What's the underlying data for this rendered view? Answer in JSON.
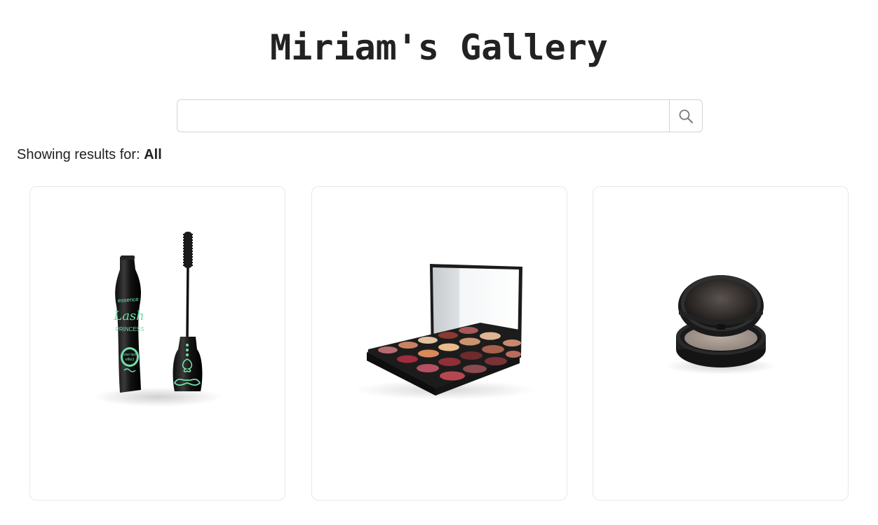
{
  "header": {
    "title": "Miriam's Gallery"
  },
  "search": {
    "value": "",
    "placeholder": "",
    "icon": "search-icon"
  },
  "results": {
    "prefix": "Showing results for: ",
    "filter": "All"
  },
  "gallery": {
    "items": [
      {
        "name": "mascara",
        "brand_text": "essence",
        "product_text": "Lash Princess"
      },
      {
        "name": "eyeshadow-palette"
      },
      {
        "name": "compact-powder"
      }
    ]
  },
  "colors": {
    "text": "#222222",
    "border": "#cfd4da",
    "card_border": "#e6e8eb",
    "mascara_accent": "#6fe0a8"
  }
}
